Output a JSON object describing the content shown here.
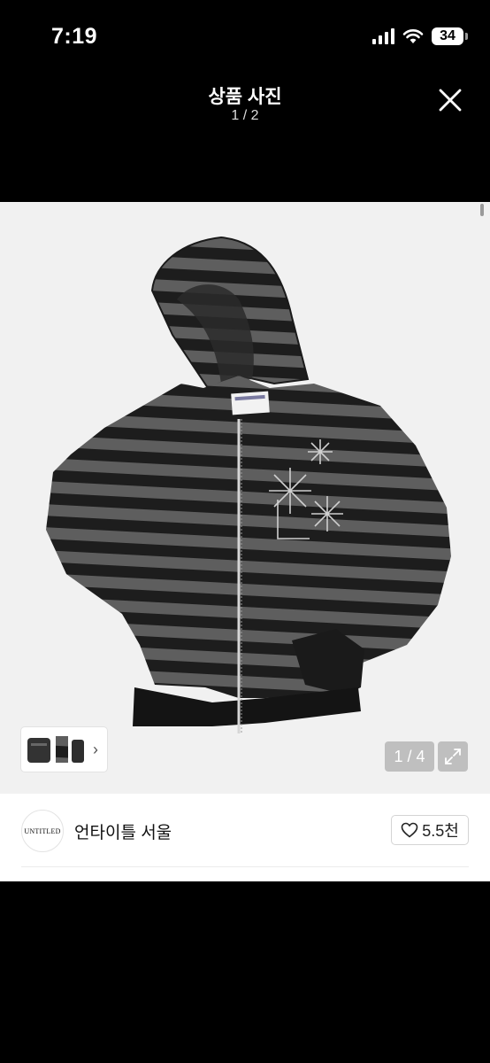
{
  "status_bar": {
    "time": "7:19",
    "battery": "34"
  },
  "viewer": {
    "title": "상품 사진",
    "counter": "1 / 2"
  },
  "photo": {
    "page_indicator": "1 / 4",
    "description": "gray and black striped zip-up hoodie"
  },
  "shop": {
    "name": "언타이틀 서울",
    "avatar_text": "UNTITLED",
    "likes": "5.5천"
  },
  "colors": {
    "stripe_dark": "#1d1d1d",
    "stripe_gray": "#5e5e5e",
    "background": "#000000"
  }
}
